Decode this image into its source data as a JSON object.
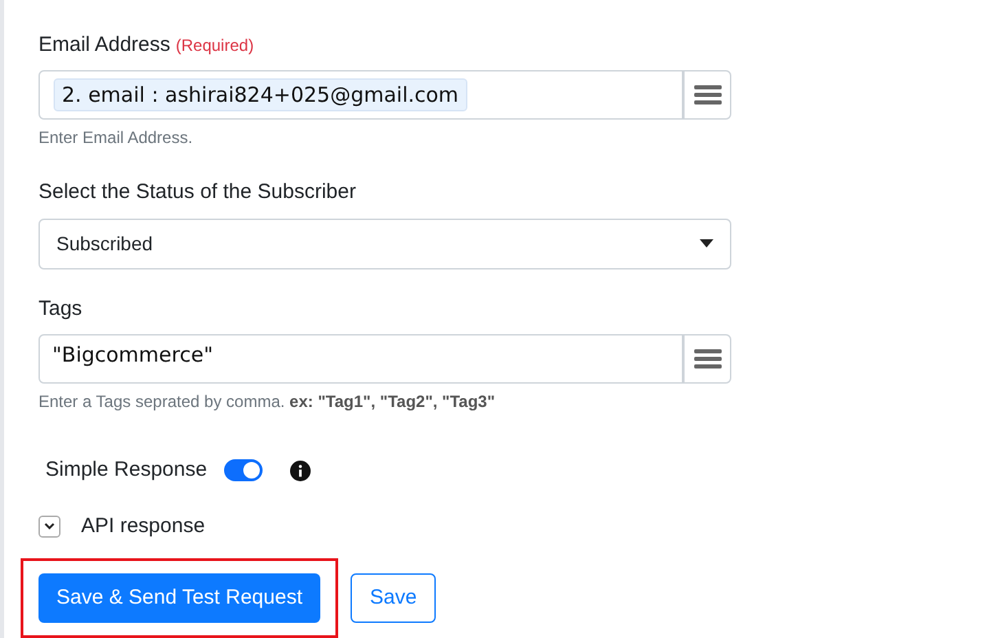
{
  "email": {
    "label": "Email Address",
    "required": "(Required)",
    "token": "2. email : ashirai824+025@gmail.com",
    "help": "Enter Email Address."
  },
  "status": {
    "label": "Select the Status of the Subscriber",
    "value": "Subscribed"
  },
  "tags": {
    "label": "Tags",
    "value": "\"Bigcommerce\"",
    "help": "Enter a Tags seprated by comma. **ex: \"Tag1\", \"Tag2\", \"Tag3\"**"
  },
  "simple_response": {
    "label": "Simple Response",
    "on": true
  },
  "api_response": {
    "label": "API response",
    "expanded": false
  },
  "buttons": [
    {
      "label": "Save & Send Test Request",
      "kind": "primary",
      "highlighted": true
    },
    {
      "label": "Save",
      "kind": "outline",
      "highlighted": false
    }
  ]
}
